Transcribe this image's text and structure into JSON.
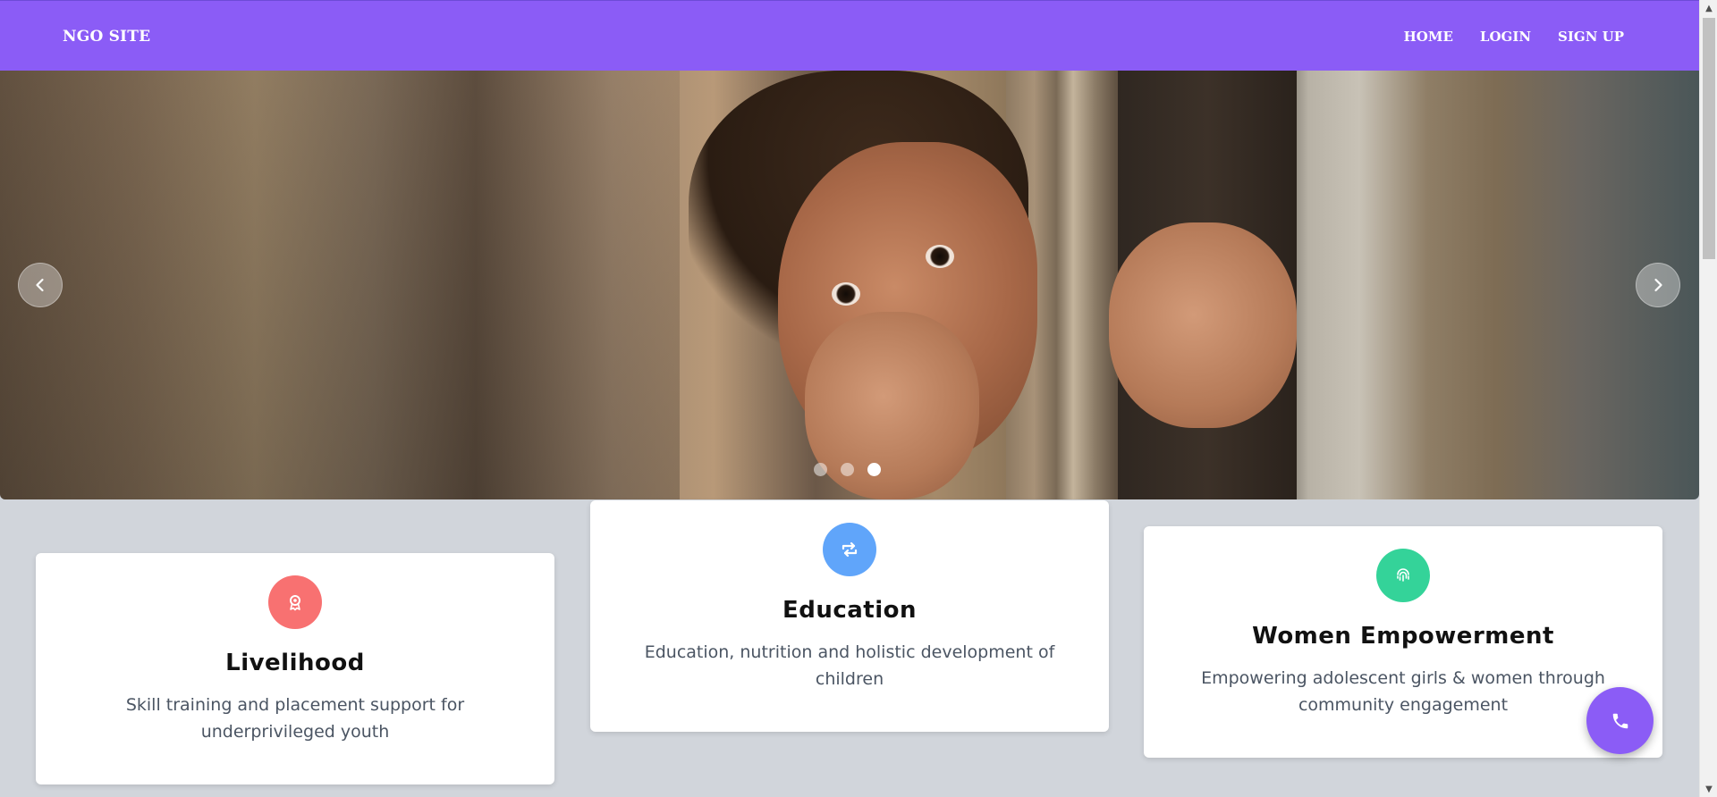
{
  "header": {
    "brand": "NGO SITE",
    "nav": [
      {
        "label": "HOME"
      },
      {
        "label": "LOGIN"
      },
      {
        "label": "SIGN UP"
      }
    ],
    "background_color": "#8b5cf6"
  },
  "carousel": {
    "slide_count": 3,
    "active_index": 3,
    "prev_icon": "chevron-left-icon",
    "next_icon": "chevron-right-icon"
  },
  "cards": [
    {
      "title": "Livelihood",
      "description": "Skill training and placement support for underprivileged youth",
      "icon": "award-ribbon-icon",
      "icon_color": "#f87171"
    },
    {
      "title": "Education",
      "description": "Education, nutrition and holistic development of children",
      "icon": "repeat-icon",
      "icon_color": "#60a5fa"
    },
    {
      "title": "Women Empowerment",
      "description": "Empowering adolescent girls & women through community engagement",
      "icon": "fingerprint-icon",
      "icon_color": "#34d399"
    }
  ],
  "floating_button": {
    "icon": "phone-icon",
    "color": "#8b5cf6"
  }
}
